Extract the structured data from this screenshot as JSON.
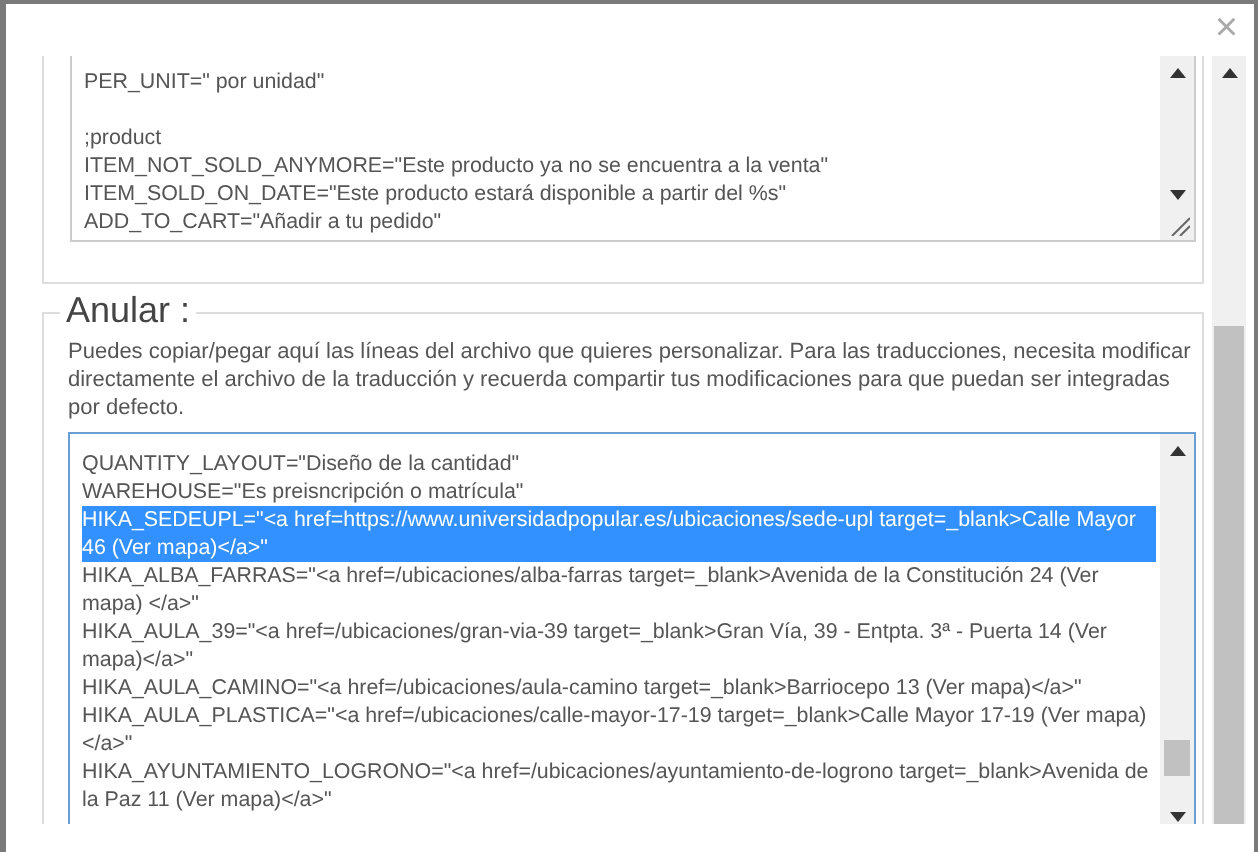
{
  "close_button": "×",
  "top_editor": {
    "lines": [
      {
        "kind": "code",
        "text": "PER_UNIT=\" por unidad\"",
        "selected": false
      },
      {
        "kind": "blank"
      },
      {
        "kind": "code",
        "text": ";product",
        "selected": false
      },
      {
        "kind": "code",
        "text": "ITEM_NOT_SOLD_ANYMORE=\"Este producto ya no se encuentra a la venta\"",
        "selected": false
      },
      {
        "kind": "code",
        "text": "ITEM_SOLD_ON_DATE=\"Este producto estará disponible a partir del %s\"",
        "selected": false
      },
      {
        "kind": "code",
        "text": "ADD_TO_CART=\"Añadir a tu pedido\"",
        "selected": false
      }
    ]
  },
  "override": {
    "legend": "Anular :",
    "description": "Puedes copiar/pegar aquí las líneas del archivo que quieres personalizar. Para las traducciones, necesita modificar directamente el archivo de la traducción y recuerda compartir tus modificaciones para que puedan ser integradas por defecto.",
    "lines": [
      {
        "text": "QUANTITY_LAYOUT=\"Diseño de la cantidad\"",
        "selected": false
      },
      {
        "text": "WAREHOUSE=\"Es preisncripción o matrícula\"",
        "selected": false
      },
      {
        "text": "HIKA_SEDEUPL=\"<a href=https://www.universidadpopular.es/ubicaciones/sede-upl target=_blank>Calle Mayor 46 (Ver mapa)</a>\"",
        "selected": true
      },
      {
        "text": "HIKA_ALBA_FARRAS=\"<a href=/ubicaciones/alba-farras target=_blank>Avenida de la Constitución 24 (Ver mapa) </a>\"",
        "selected": false
      },
      {
        "text": "HIKA_AULA_39=\"<a href=/ubicaciones/gran-via-39 target=_blank>Gran Vía, 39 - Entpta. 3ª - Puerta 14 (Ver mapa)</a>\"",
        "selected": false
      },
      {
        "text": "HIKA_AULA_CAMINO=\"<a href=/ubicaciones/aula-camino target=_blank>Barriocepo 13 (Ver mapa)</a>\"",
        "selected": false
      },
      {
        "text": "HIKA_AULA_PLASTICA=\"<a href=/ubicaciones/calle-mayor-17-19 target=_blank>Calle Mayor 17-19 (Ver mapa) </a>\"",
        "selected": false
      },
      {
        "text": "HIKA_AYUNTAMIENTO_LOGRONO=\"<a href=/ubicaciones/ayuntamiento-de-logrono target=_blank>Avenida de la Paz 11 (Ver mapa)</a>\"",
        "selected": false
      }
    ]
  }
}
